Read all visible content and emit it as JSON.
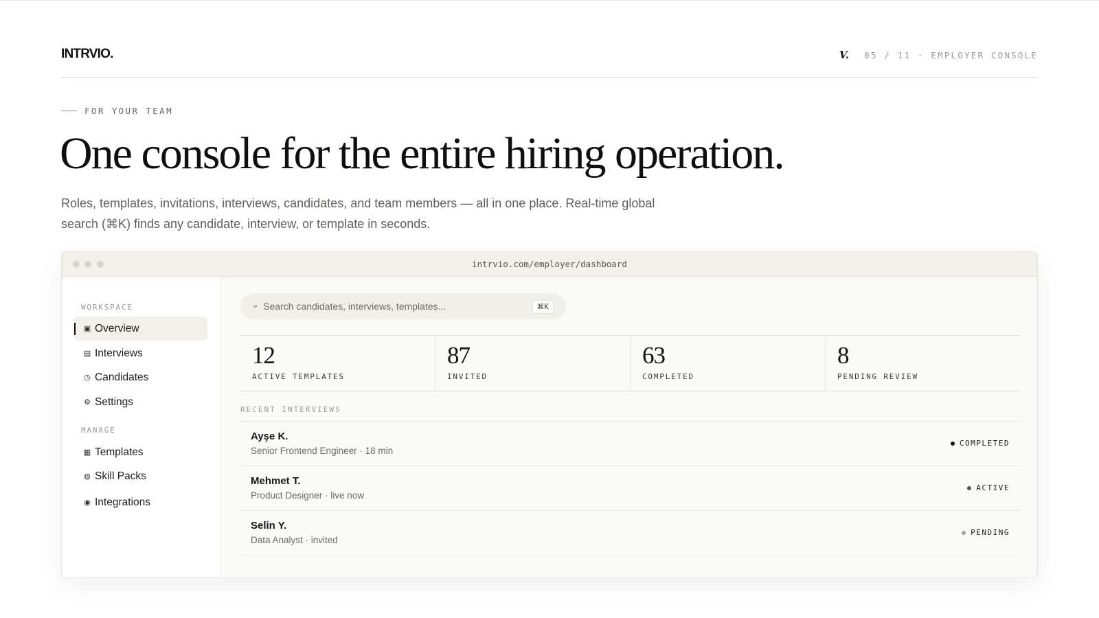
{
  "brand": {
    "logo": "INTRVIO.",
    "mark": "V.",
    "slide_meta": "05 / 11 · EMPLOYER CONSOLE"
  },
  "hero": {
    "eyebrow": "FOR YOUR TEAM",
    "headline": "One console for the entire hiring operation.",
    "subhead": "Roles, templates, invitations, interviews, candidates, and team members — all in one place. Real-time global search (⌘K) finds any candidate, interview, or template in seconds."
  },
  "browser": {
    "url": "intrvio.com/employer/dashboard"
  },
  "sidebar": {
    "workspace_label": "WORKSPACE",
    "manage_label": "MANAGE",
    "workspace_items": [
      {
        "label": "Overview",
        "icon": "▣",
        "icon_name": "overview-icon",
        "active": true
      },
      {
        "label": "Interviews",
        "icon": "▤",
        "icon_name": "interviews-icon",
        "active": false
      },
      {
        "label": "Candidates",
        "icon": "◷",
        "icon_name": "candidates-icon",
        "active": false
      },
      {
        "label": "Settings",
        "icon": "⚙",
        "icon_name": "settings-icon",
        "active": false
      }
    ],
    "manage_items": [
      {
        "label": "Templates",
        "icon": "▦",
        "icon_name": "templates-icon"
      },
      {
        "label": "Skill Packs",
        "icon": "◍",
        "icon_name": "skill-packs-icon"
      },
      {
        "label": "Integrations",
        "icon": "◉",
        "icon_name": "integrations-icon"
      }
    ]
  },
  "search": {
    "icon": "⌕",
    "placeholder": "Search candidates, interviews, templates...",
    "shortcut": "⌘K"
  },
  "stats": [
    {
      "value": "12",
      "label": "ACTIVE TEMPLATES"
    },
    {
      "value": "87",
      "label": "INVITED"
    },
    {
      "value": "63",
      "label": "COMPLETED"
    },
    {
      "value": "8",
      "label": "PENDING REVIEW"
    }
  ],
  "recent": {
    "title": "RECENT INTERVIEWS",
    "rows": [
      {
        "name": "Ayşe K.",
        "detail": "Senior Frontend Engineer · 18 min",
        "status": "COMPLETED",
        "status_color": "#111111"
      },
      {
        "name": "Mehmet T.",
        "detail": "Product Designer · live now",
        "status": "ACTIVE",
        "status_color": "#555555"
      },
      {
        "name": "Selin Y.",
        "detail": "Data Analyst · invited",
        "status": "PENDING",
        "status_color": "#a3a3a0"
      }
    ]
  }
}
